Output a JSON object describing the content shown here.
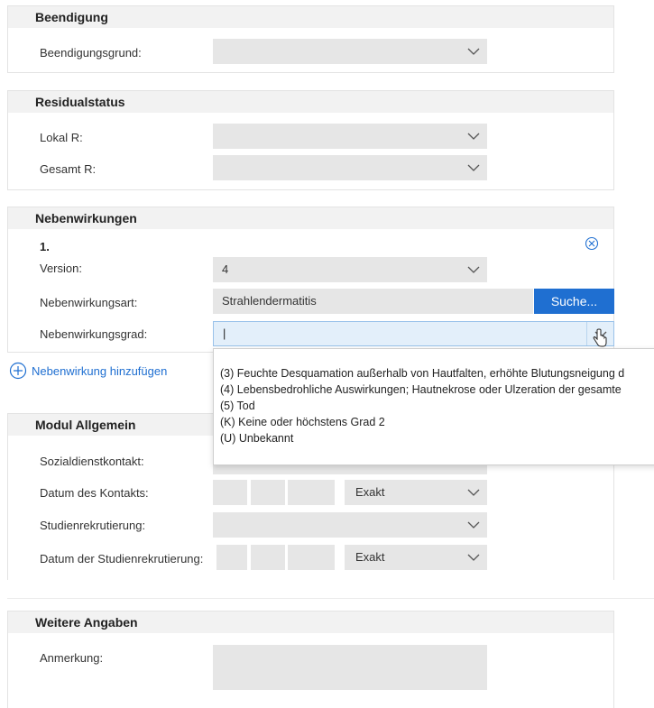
{
  "beendigung": {
    "title": "Beendigung",
    "grund_label": "Beendigungsgrund:",
    "grund_value": ""
  },
  "residual": {
    "title": "Residualstatus",
    "lokal_label": "Lokal R:",
    "lokal_value": "",
    "gesamt_label": "Gesamt R:",
    "gesamt_value": ""
  },
  "neben": {
    "title": "Nebenwirkungen",
    "item_number": "1.",
    "version_label": "Version:",
    "version_value": "4",
    "art_label": "Nebenwirkungsart:",
    "art_value": "Strahlendermatitis",
    "search_button": "Suche...",
    "grad_label": "Nebenwirkungsgrad:",
    "grad_value": "|",
    "add_label": "Nebenwirkung hinzufügen",
    "dropdown_options": [
      "(3) Feuchte Desquamation außerhalb von Hautfalten, erhöhte Blutungsneigung d",
      "(4) Lebensbedrohliche Auswirkungen; Hautnekrose oder Ulzeration der gesamte",
      "(5) Tod",
      "(K) Keine oder höchstens Grad 2",
      "(U) Unbekannt"
    ]
  },
  "modul": {
    "title": "Modul Allgemein",
    "sozial_label": "Sozialdienstkontakt:",
    "datum_label": "Datum des Kontakts:",
    "datum_mode": "Exakt",
    "studien_label": "Studienrekrutierung:",
    "studien_datum_label": "Datum der Studienrekrutierung:",
    "studien_datum_mode": "Exakt"
  },
  "weitere": {
    "title": "Weitere Angaben",
    "anmerkung_label": "Anmerkung:"
  },
  "colors": {
    "accent": "#1f6fd1",
    "field_bg": "#e6e6e6",
    "focus_bg": "#e3effa"
  }
}
